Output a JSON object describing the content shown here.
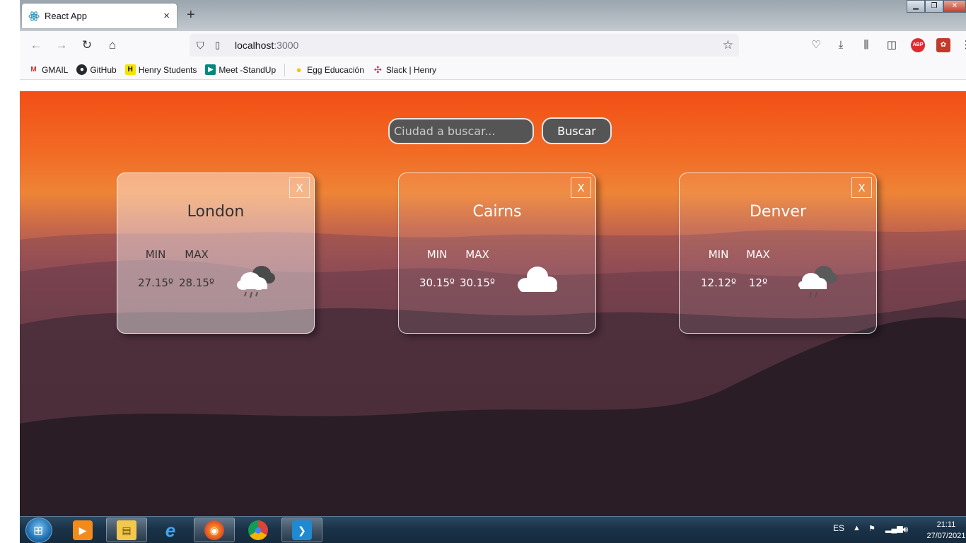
{
  "browser": {
    "tab_title": "React App",
    "tab_close": "×",
    "new_tab": "+",
    "url_host": "localhost",
    "url_port": ":3000"
  },
  "bookmarks": [
    {
      "label": "GMAIL",
      "icon": "gmail-icon",
      "color": "#d93025"
    },
    {
      "label": "GitHub",
      "icon": "github-icon",
      "color": "#24292e"
    },
    {
      "label": "Henry Students",
      "icon": "henry-icon",
      "color": "#f5e400"
    },
    {
      "label": "Meet -StandUp",
      "icon": "meet-icon",
      "color": "#00897b"
    },
    {
      "label": "Egg Educación",
      "icon": "egg-icon",
      "color": "#f7c600"
    },
    {
      "label": "Slack | Henry",
      "icon": "slack-icon",
      "color": "#4a154b"
    }
  ],
  "search": {
    "placeholder": "Ciudad a buscar...",
    "button_label": "Buscar"
  },
  "cards": [
    {
      "city": "London",
      "min_label": "MIN",
      "max_label": "MAX",
      "min": "27.15º",
      "max": "28.15º",
      "close": "X",
      "icon": "rain-cloud-icon",
      "tint": "light"
    },
    {
      "city": "Cairns",
      "min_label": "MIN",
      "max_label": "MAX",
      "min": "30.15º",
      "max": "30.15º",
      "close": "X",
      "icon": "cloud-icon",
      "tint": "clear"
    },
    {
      "city": "Denver",
      "min_label": "MIN",
      "max_label": "MAX",
      "min": "12.12º",
      "max": "12º",
      "close": "X",
      "icon": "storm-cloud-icon",
      "tint": "clear"
    }
  ],
  "taskbar": {
    "language": "ES",
    "time": "21:11",
    "date": "27/07/2021",
    "apps": [
      "media-player",
      "file-explorer",
      "internet-explorer",
      "firefox",
      "chrome",
      "vscode"
    ]
  }
}
